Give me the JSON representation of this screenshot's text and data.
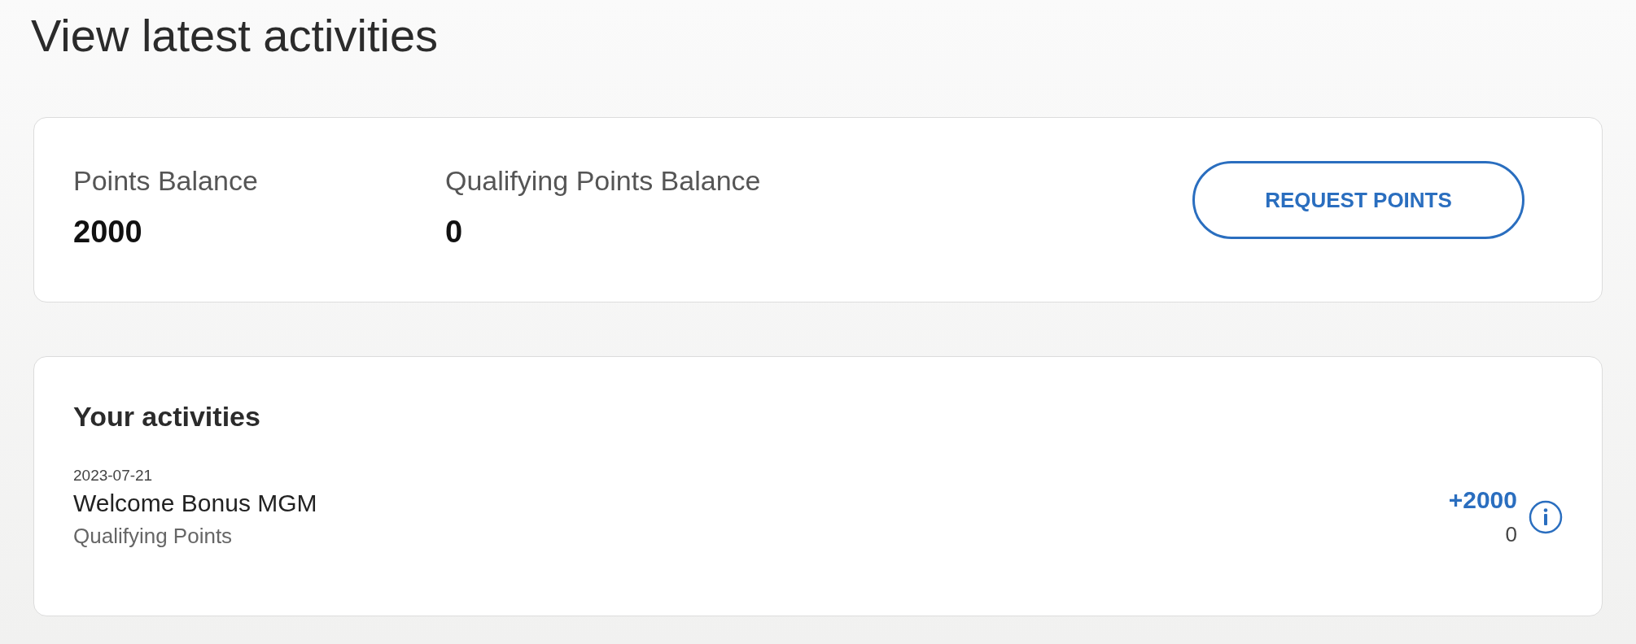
{
  "title": "View latest activities",
  "balances": [
    {
      "label": "Points Balance",
      "value": "2000"
    },
    {
      "label": "Qualifying Points Balance",
      "value": "0"
    }
  ],
  "request_button": "REQUEST POINTS",
  "activities": {
    "heading": "Your activities",
    "items": [
      {
        "date": "2023-07-21",
        "name": "Welcome Bonus MGM",
        "sub_label": "Qualifying Points",
        "points": "+2000",
        "qualifying_points": "0"
      }
    ]
  }
}
